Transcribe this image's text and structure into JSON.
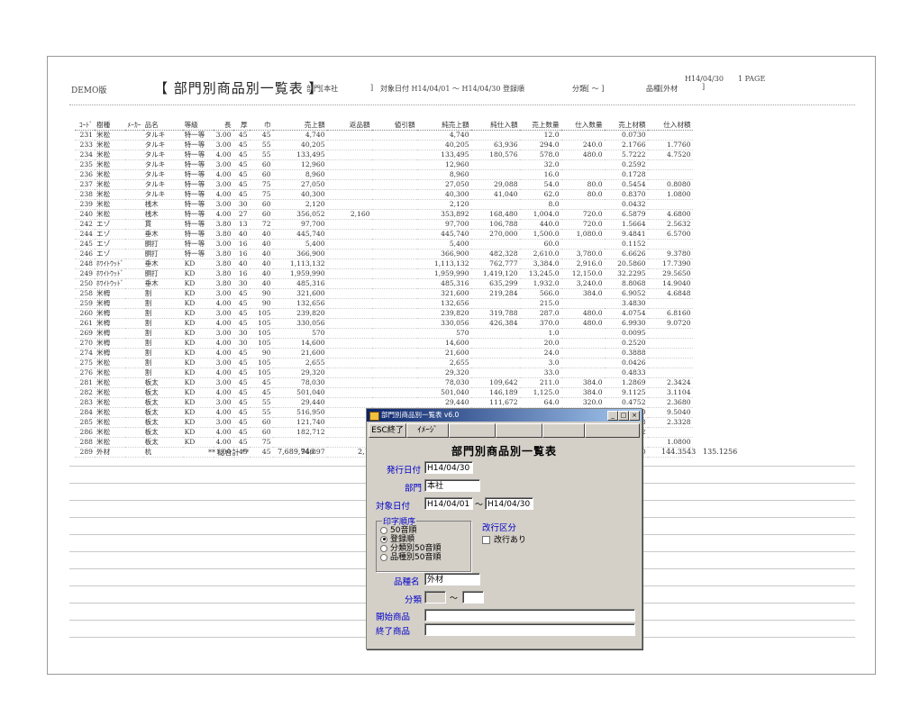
{
  "header": {
    "demo": "DEMO版",
    "title": "【 部門別商品別一覧表 】",
    "dept": "部門[本社",
    "dept_close": "]",
    "date_range": "対象日付 H14/04/01 ～ H14/04/30",
    "order": "登録順",
    "class": "分類[   ～   ]",
    "kind": "品種[外材",
    "kind_close": "]",
    "print_date": "H14/04/30",
    "page": "1 PAGE"
  },
  "columns": [
    "ｺｰﾄﾞ",
    "樹種",
    "ﾒｰｶｰ",
    "品名",
    "等級",
    "長",
    "厚",
    "巾",
    "売上額",
    "返品額",
    "値引額",
    "純売上額",
    "純仕入額",
    "売上数量",
    "仕入数量",
    "売上材積",
    "仕入材積"
  ],
  "rows": [
    [
      "231",
      "米松",
      "",
      "タルキ",
      "特一等",
      "3.00",
      "45",
      "45",
      "4,740",
      "",
      "",
      "4,740",
      "",
      "12.0",
      "",
      "0.0730",
      ""
    ],
    [
      "233",
      "米松",
      "",
      "タルキ",
      "特一等",
      "3.00",
      "45",
      "55",
      "40,205",
      "",
      "",
      "40,205",
      "63,936",
      "294.0",
      "240.0",
      "2.1766",
      "1.7760"
    ],
    [
      "234",
      "米松",
      "",
      "タルキ",
      "特一等",
      "4.00",
      "45",
      "55",
      "133,495",
      "",
      "",
      "133,495",
      "180,576",
      "578.0",
      "480.0",
      "5.7222",
      "4.7520"
    ],
    [
      "235",
      "米松",
      "",
      "タルキ",
      "特一等",
      "3.00",
      "45",
      "60",
      "12,960",
      "",
      "",
      "12,960",
      "",
      "32.0",
      "",
      "0.2592",
      ""
    ],
    [
      "236",
      "米松",
      "",
      "タルキ",
      "特一等",
      "4.00",
      "45",
      "60",
      "8,960",
      "",
      "",
      "8,960",
      "",
      "16.0",
      "",
      "0.1728",
      ""
    ],
    [
      "237",
      "米松",
      "",
      "タルキ",
      "特一等",
      "3.00",
      "45",
      "75",
      "27,050",
      "",
      "",
      "27,050",
      "29,088",
      "54.0",
      "80.0",
      "0.5454",
      "0.8080"
    ],
    [
      "238",
      "米松",
      "",
      "タルキ",
      "特一等",
      "4.00",
      "45",
      "75",
      "40,300",
      "",
      "",
      "40,300",
      "41,040",
      "62.0",
      "80.0",
      "0.8370",
      "1.0800"
    ],
    [
      "239",
      "米松",
      "",
      "桟木",
      "特一等",
      "3.00",
      "30",
      "60",
      "2,120",
      "",
      "",
      "2,120",
      "",
      "8.0",
      "",
      "0.0432",
      ""
    ],
    [
      "240",
      "米松",
      "",
      "桟木",
      "特一等",
      "4.00",
      "27",
      "60",
      "356,052",
      "2,160",
      "",
      "353,892",
      "168,480",
      "1,004.0",
      "720.0",
      "6.5879",
      "4.6800"
    ],
    [
      "242",
      "エゾ",
      "",
      "貫",
      "特一等",
      "3.80",
      "13",
      "72",
      "97,700",
      "",
      "",
      "97,700",
      "106,788",
      "440.0",
      "720.0",
      "1.5664",
      "2.5632"
    ],
    [
      "244",
      "エゾ",
      "",
      "垂木",
      "特一等",
      "3.80",
      "40",
      "40",
      "445,740",
      "",
      "",
      "445,740",
      "270,000",
      "1,500.0",
      "1,080.0",
      "9.4841",
      "6.5700"
    ],
    [
      "245",
      "エゾ",
      "",
      "胴打",
      "特一等",
      "3.00",
      "16",
      "40",
      "5,400",
      "",
      "",
      "5,400",
      "",
      "60.0",
      "",
      "0.1152",
      ""
    ],
    [
      "246",
      "エゾ",
      "",
      "胴打",
      "特一等",
      "3.80",
      "16",
      "40",
      "366,900",
      "",
      "",
      "366,900",
      "482,328",
      "2,610.0",
      "3,780.0",
      "6.6626",
      "9.3780"
    ],
    [
      "248",
      "ﾎﾜｲﾄｳｯﾄﾞ",
      "",
      "垂木",
      "KD",
      "3.80",
      "40",
      "40",
      "1,113,132",
      "",
      "",
      "1,113,132",
      "762,777",
      "3,384.0",
      "2,916.0",
      "20.5860",
      "17.7390"
    ],
    [
      "249",
      "ﾎﾜｲﾄｳｯﾄﾞ",
      "",
      "胴打",
      "KD",
      "3.80",
      "16",
      "40",
      "1,959,990",
      "",
      "",
      "1,959,990",
      "1,419,120",
      "13,245.0",
      "12,150.0",
      "32.2295",
      "29.5650"
    ],
    [
      "250",
      "ﾎﾜｲﾄｳｯﾄﾞ",
      "",
      "垂木",
      "KD",
      "3.80",
      "30",
      "40",
      "485,316",
      "",
      "",
      "485,316",
      "635,299",
      "1,932.0",
      "3,240.0",
      "8.8068",
      "14.9040"
    ],
    [
      "258",
      "米栂",
      "",
      "割",
      "KD",
      "3.00",
      "45",
      "90",
      "321,600",
      "",
      "",
      "321,600",
      "219,284",
      "566.0",
      "384.0",
      "6.9052",
      "4.6848"
    ],
    [
      "259",
      "米栂",
      "",
      "割",
      "KD",
      "4.00",
      "45",
      "90",
      "132,656",
      "",
      "",
      "132,656",
      "",
      "215.0",
      "",
      "3.4830",
      ""
    ],
    [
      "260",
      "米栂",
      "",
      "割",
      "KD",
      "3.00",
      "45",
      "105",
      "239,820",
      "",
      "",
      "239,820",
      "319,788",
      "287.0",
      "480.0",
      "4.0754",
      "6.8160"
    ],
    [
      "261",
      "米栂",
      "",
      "割",
      "KD",
      "4.00",
      "45",
      "105",
      "330,056",
      "",
      "",
      "330,056",
      "426,384",
      "370.0",
      "480.0",
      "6.9930",
      "9.0720"
    ],
    [
      "269",
      "米栂",
      "",
      "割",
      "KD",
      "3.00",
      "30",
      "105",
      "570",
      "",
      "",
      "570",
      "",
      "1.0",
      "",
      "0.0095",
      ""
    ],
    [
      "270",
      "米栂",
      "",
      "割",
      "KD",
      "4.00",
      "30",
      "105",
      "14,600",
      "",
      "",
      "14,600",
      "",
      "20.0",
      "",
      "0.2520",
      ""
    ],
    [
      "274",
      "米栂",
      "",
      "割",
      "KD",
      "4.00",
      "45",
      "90",
      "21,600",
      "",
      "",
      "21,600",
      "",
      "24.0",
      "",
      "0.3888",
      ""
    ],
    [
      "275",
      "米松",
      "",
      "割",
      "KD",
      "3.00",
      "45",
      "105",
      "2,655",
      "",
      "",
      "2,655",
      "",
      "3.0",
      "",
      "0.0426",
      ""
    ],
    [
      "276",
      "米松",
      "",
      "割",
      "KD",
      "4.00",
      "45",
      "105",
      "29,320",
      "",
      "",
      "29,320",
      "",
      "33.0",
      "",
      "0.4833",
      ""
    ],
    [
      "281",
      "米松",
      "",
      "板太",
      "KD",
      "3.00",
      "45",
      "45",
      "78,030",
      "",
      "",
      "78,030",
      "109,642",
      "211.0",
      "384.0",
      "1.2869",
      "2.3424"
    ],
    [
      "282",
      "米松",
      "",
      "板太",
      "KD",
      "4.00",
      "45",
      "45",
      "501,040",
      "",
      "",
      "501,040",
      "146,189",
      "1,125.0",
      "384.0",
      "9.1125",
      "3.1104"
    ],
    [
      "283",
      "米松",
      "",
      "板太",
      "KD",
      "3.00",
      "45",
      "55",
      "29,440",
      "",
      "",
      "29,440",
      "111,672",
      "64.0",
      "320.0",
      "0.4752",
      "2.3680"
    ],
    [
      "284",
      "米松",
      "",
      "板太",
      "KD",
      "4.00",
      "45",
      "55",
      "516,950",
      "",
      "",
      "516,950",
      "446,688",
      "890.0",
      "960.0",
      "8.8110",
      "9.5040"
    ],
    [
      "285",
      "米松",
      "",
      "板太",
      "KD",
      "3.00",
      "45",
      "60",
      "121,740",
      "",
      "",
      "121,740",
      "109,642",
      "248.0",
      "",
      "2.0088",
      "2.3328"
    ],
    [
      "286",
      "米松",
      "",
      "板太",
      "KD",
      "4.00",
      "45",
      "60",
      "182,712",
      "",
      "",
      "",
      "",
      "",
      "",
      "3.0672",
      ""
    ],
    [
      "288",
      "米松",
      "",
      "板太",
      "KD",
      "4.00",
      "45",
      "75",
      "",
      "",
      "",
      "",
      "",
      "",
      "",
      "",
      "1.0800"
    ],
    [
      "289",
      "外材",
      "",
      "杭",
      "",
      "1.00",
      "45",
      "45",
      "96,897",
      "",
      "",
      "",
      "",
      "",
      "",
      "1.0920",
      ""
    ]
  ],
  "totals": {
    "label": "** 総合計 **",
    "sales": "7,689,746",
    "returns": "2,1",
    "sales_vol": "144.3543",
    "buy_vol": "135.1256"
  },
  "dialog": {
    "window_title": "部門別商品別一覧表 v6.0",
    "esc_button": "ESC終了",
    "image_button": "ｲﾒｰｼﾞ",
    "heading": "部門別商品別一覧表",
    "issue_date_label": "発行日付",
    "issue_date": "H14/04/30",
    "dept_label": "部門",
    "dept": "本社",
    "target_date_label": "対象日付",
    "date_from": "H14/04/01",
    "tilde": "～",
    "date_to": "H14/04/30",
    "print_order_label": "印字順序",
    "options": [
      "50音順",
      "登録順",
      "分類別50音順",
      "品種別50音順"
    ],
    "selected_option": 1,
    "pagebreak_label": "改行区分",
    "pagebreak_check": "改行あり",
    "kind_label": "品種名",
    "kind": "外材",
    "class_label": "分類",
    "start_label": "開始商品",
    "end_label": "終了商品"
  }
}
